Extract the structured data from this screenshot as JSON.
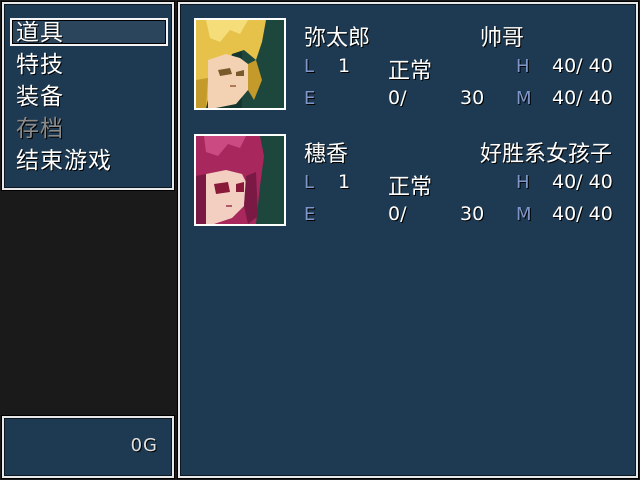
{
  "menu": {
    "items": [
      {
        "label": "道具",
        "enabled": true
      },
      {
        "label": "特技",
        "enabled": true
      },
      {
        "label": "装备",
        "enabled": true
      },
      {
        "label": "存档",
        "enabled": false
      },
      {
        "label": "结束游戏",
        "enabled": true
      }
    ],
    "selected_index": 0
  },
  "gold": {
    "value": "0G"
  },
  "labels": {
    "level": "L",
    "exp": "E",
    "hp": "H",
    "mp": "M"
  },
  "party": [
    {
      "name": "弥太郎",
      "title": "帅哥",
      "level": "1",
      "status": "正常",
      "hp": "40/ 40",
      "exp": "0/",
      "exp_next": "30",
      "mp": "40/ 40",
      "portrait": "blonde-hair-portrait"
    },
    {
      "name": "穗香",
      "title": "好胜系女孩子",
      "level": "1",
      "status": "正常",
      "hp": "40/ 40",
      "exp": "0/",
      "exp_next": "30",
      "mp": "40/ 40",
      "portrait": "magenta-hair-portrait"
    }
  ],
  "colors": {
    "window_bg": "#1d3a52",
    "border": "#e8e8e8",
    "label": "#7e96c8",
    "disabled": "#8a8a8a"
  }
}
